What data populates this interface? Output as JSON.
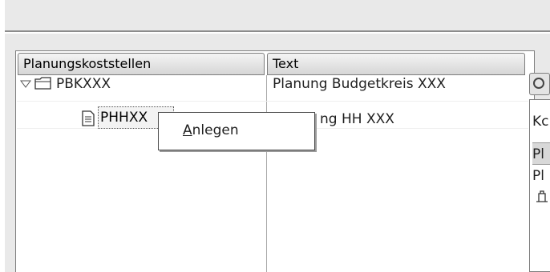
{
  "tree": {
    "columns": [
      "Planungskoststellen",
      "Text"
    ],
    "rows": [
      {
        "node": "PBKXXX",
        "text": "Planung Budgetkreis XXX",
        "type": "folder",
        "expanded": true
      },
      {
        "node": "PHHXX",
        "text": "ng HH XXX",
        "type": "document",
        "focused": true
      }
    ]
  },
  "context_menu": {
    "items": [
      {
        "label_mnemonic": "A",
        "label_rest": "nlegen"
      }
    ]
  },
  "right_panel": {
    "cells": [
      "Kc",
      "Pl",
      "Pl"
    ]
  },
  "icons": {
    "toggle": "expand-triangle-icon",
    "folder": "folder-icon",
    "document": "document-icon",
    "button": "refresh-icon",
    "row": "structure-icon"
  }
}
